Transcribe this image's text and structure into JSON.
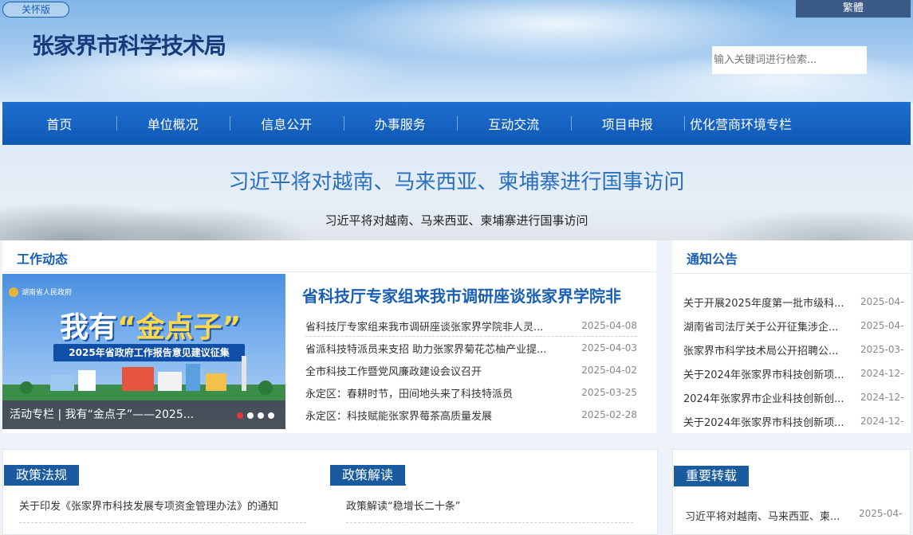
{
  "header": {
    "care_label": "关怀版",
    "traditional_label": "繁體",
    "site_title": "张家界市科学技术局",
    "search_placeholder": "输入关键词进行检索..."
  },
  "nav": {
    "items": [
      "首页",
      "单位概况",
      "信息公开",
      "办事服务",
      "互动交流",
      "项目申报",
      "优化营商环境专栏"
    ]
  },
  "banner": {
    "headline": "习近平将对越南、马来西亚、柬埔寨进行国事访问",
    "subline": "习近平将对越南、马来西亚、柬埔寨进行国事访问"
  },
  "work_news": {
    "title": "工作动态",
    "slide": {
      "gov_label": "湖南省人民政府",
      "big_text_a": "我有",
      "big_text_b": "“金点子”",
      "sub_banner": "2025年省政府工作报告意见建议征集",
      "caption": "活动专栏 | 我有“金点子”——2025..."
    },
    "featured": "省科技厅专家组来我市调研座谈张家界学院非",
    "items": [
      {
        "title": "省科技厅专家组来我市调研座谈张家界学院非人灵...",
        "date": "2025-04-08"
      },
      {
        "title": "省派科技特派员来支招 助力张家界菊花芯柚产业提...",
        "date": "2025-04-03"
      },
      {
        "title": "全市科技工作暨党风廉政建设会议召开",
        "date": "2025-04-02"
      },
      {
        "title": "永定区：春耕时节，田间地头来了科技特派员",
        "date": "2025-03-25"
      },
      {
        "title": "永定区：科技赋能张家界莓茶高质量发展",
        "date": "2025-02-28"
      }
    ]
  },
  "notices": {
    "title": "通知公告",
    "items": [
      {
        "title": "关于开展2025年度第一批市级科...",
        "date": "2025-04-"
      },
      {
        "title": "湖南省司法厅关于公开征集涉企...",
        "date": "2025-04-"
      },
      {
        "title": "张家界市科学技术局公开招聘公...",
        "date": "2025-03-"
      },
      {
        "title": "关于2024年张家界市科技创新项...",
        "date": "2024-12-"
      },
      {
        "title": "2024年张家界市企业科技创新创...",
        "date": "2024-12-"
      },
      {
        "title": "关于2024年张家界市科技创新项...",
        "date": "2024-12-"
      }
    ]
  },
  "policy": {
    "regulations_title": "政策法规",
    "regulations_item": "关于印发《张家界市科技发展专项资金管理办法》的通知",
    "interpretation_title": "政策解读",
    "interpretation_item": "政策解读“稳增长二十条”"
  },
  "reposts": {
    "title": "重要转载",
    "items": [
      {
        "title": "习近平将对越南、马来西亚、柬...",
        "date": "2025-04-"
      }
    ]
  }
}
